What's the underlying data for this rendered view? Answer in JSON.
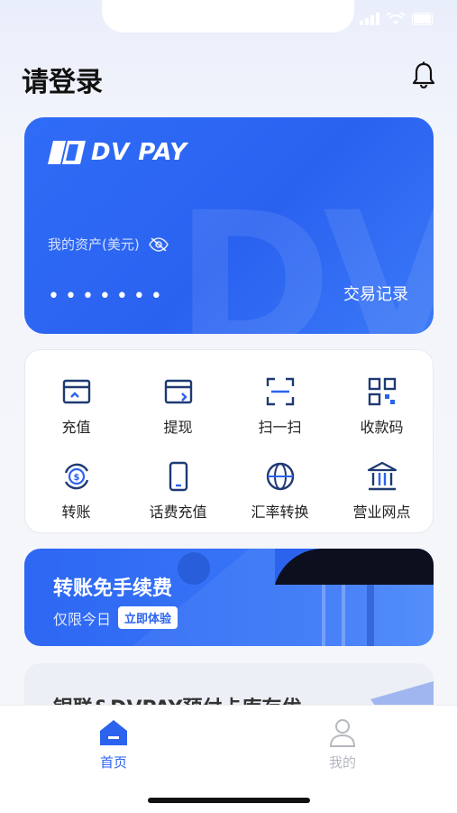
{
  "header": {
    "title": "请登录"
  },
  "card": {
    "brand": "DV PAY",
    "watermark": "DV",
    "asset_label": "我的资产(美元)",
    "masked_amount": "•••••••",
    "records_link": "交易记录"
  },
  "actions": [
    {
      "label": "充值",
      "icon": "recharge-icon"
    },
    {
      "label": "提现",
      "icon": "withdraw-icon"
    },
    {
      "label": "扫一扫",
      "icon": "scan-icon"
    },
    {
      "label": "收款码",
      "icon": "qr-code-icon"
    },
    {
      "label": "转账",
      "icon": "transfer-icon"
    },
    {
      "label": "话费充值",
      "icon": "phone-icon"
    },
    {
      "label": "汇率转换",
      "icon": "globe-icon"
    },
    {
      "label": "营业网点",
      "icon": "bank-icon"
    }
  ],
  "banner": {
    "title": "转账免手续费",
    "subtitle": "仅限今日",
    "cta": "立即体验"
  },
  "partial_card": {
    "text": "银联&DVPAY预付卡库存优"
  },
  "tabbar": {
    "home": "首页",
    "mine": "我的"
  },
  "colors": {
    "accent": "#2b63ef",
    "inactive": "#b5b8c0"
  }
}
